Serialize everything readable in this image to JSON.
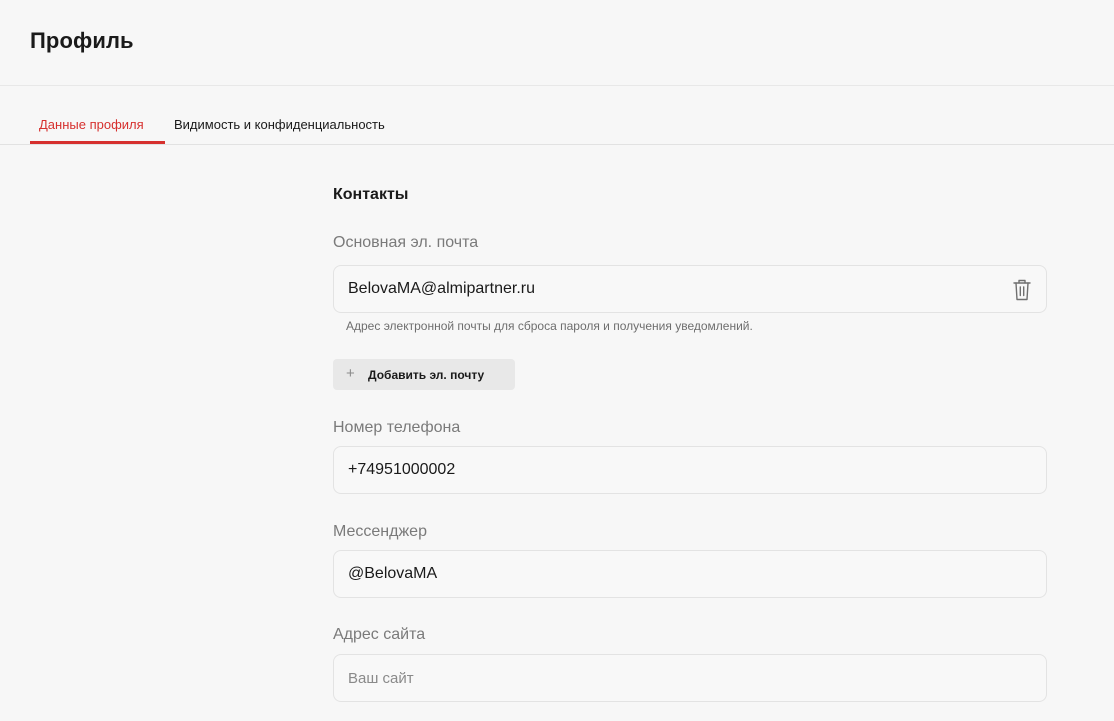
{
  "header": {
    "title": "Профиль"
  },
  "tabs": [
    {
      "label": "Данные профиля",
      "active": true
    },
    {
      "label": "Видимость и конфиденциальность",
      "active": false
    }
  ],
  "contacts": {
    "section_title": "Контакты",
    "email": {
      "label": "Основная эл. почта",
      "value": "BelovaMA@almipartner.ru",
      "hint": "Адрес электронной почты для сброса пароля и получения уведомлений.",
      "delete_icon": "trash-icon"
    },
    "add_email_button": {
      "icon": "+",
      "label": "Добавить эл. почту"
    },
    "phone": {
      "label": "Номер телефона",
      "value": "+74951000002"
    },
    "messenger": {
      "label": "Мессенджер",
      "value": "@BelovaMA"
    },
    "website": {
      "label": "Адрес сайта",
      "value": "",
      "placeholder": "Ваш сайт"
    }
  },
  "colors": {
    "accent": "#d6302e",
    "background": "#f7f7f7",
    "field_border": "#e3e3e3",
    "button_bg": "#e8e8e8"
  }
}
